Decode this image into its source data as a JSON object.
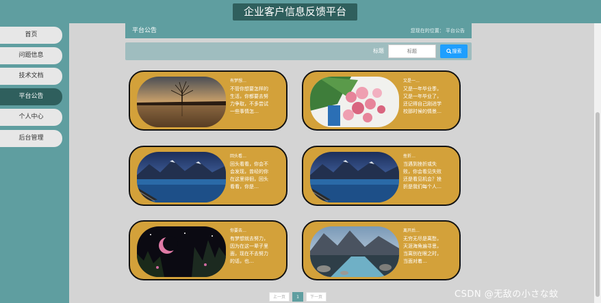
{
  "header": {
    "title": "企业客户信息反馈平台"
  },
  "sidebar": {
    "items": [
      {
        "label": "首页",
        "active": false
      },
      {
        "label": "问题信息",
        "active": false
      },
      {
        "label": "技术文档",
        "active": false
      },
      {
        "label": "平台公告",
        "active": true
      },
      {
        "label": "个人中心",
        "active": false
      },
      {
        "label": "后台管理",
        "active": false
      }
    ]
  },
  "breadcrumb": {
    "title": "平台公告",
    "location": "您现在的位置：  平台公告"
  },
  "search": {
    "label": "标题",
    "placeholder": "标题",
    "button": "搜索",
    "button_color": "#1e9fff"
  },
  "cards": [
    {
      "title": "有梦想…",
      "excerpt": "不管你想要怎样的生活，你都要去努力争取，不多尝试一些事情怎…",
      "image": "lone-tree-lake"
    },
    {
      "title": "又是一…",
      "excerpt": "又是一年毕业季，又是一年毕业了，还记得自己刚进学校那时候的情景…",
      "image": "pink-roses"
    },
    {
      "title": "回头看…",
      "excerpt": "回头看看，你会不会发现，曾经的你在这里徘徊，回头看看，你是…",
      "image": "mountain-lake"
    },
    {
      "title": "挫折…",
      "excerpt": "当遇到挫折或失败，你会看见失败还是看见机会？挫折是我们每个人…",
      "image": "mountain-lake"
    },
    {
      "title": "你要去…",
      "excerpt": "有梦想就去努力，因为在这一辈子里面，现在不去努力的话，也…",
      "image": "night-moon"
    },
    {
      "title": "离开后…",
      "excerpt": "无穷无尽是离愁，天涯海角遍寻思，当离别在眼之时，当面对着…",
      "image": "mountain-river"
    }
  ],
  "pagination": {
    "prev": "上一页",
    "current": "1",
    "next": "下一页"
  },
  "colors": {
    "header": "#5f9ea0",
    "active": "#2f5f5d",
    "card": "#d3a13a"
  },
  "watermark": "CSDN @无敌の小さな蚊"
}
